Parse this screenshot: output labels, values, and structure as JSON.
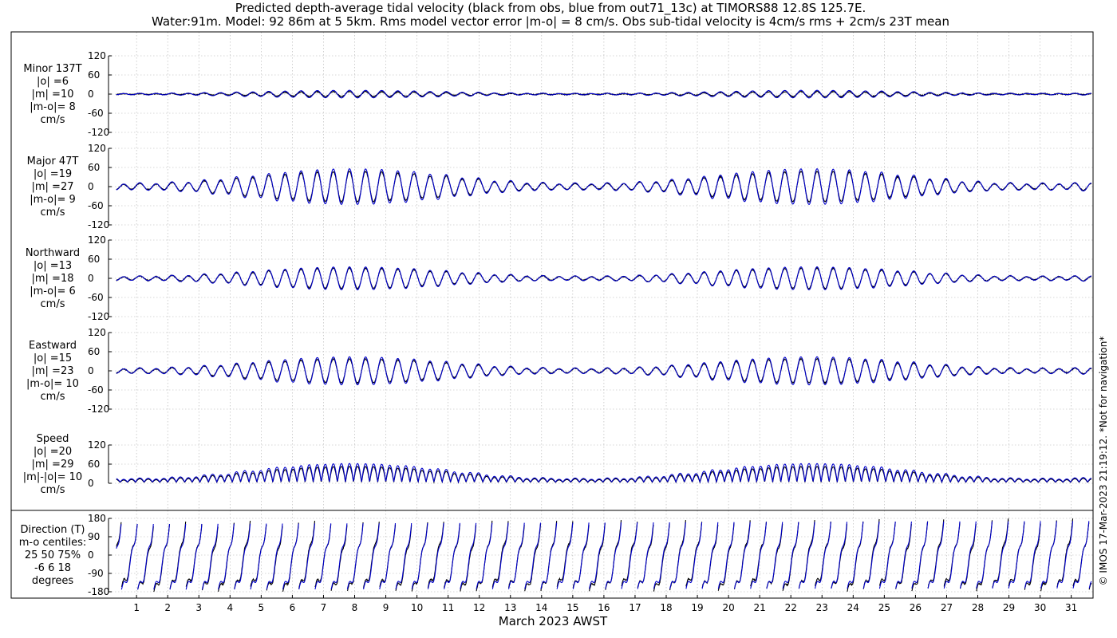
{
  "title_line1": "Predicted depth-average tidal velocity (black from obs, blue from out71_13c) at TIMORS88 12.8S 125.7E.",
  "title_line2": "Water:91m. Model: 92 86m at 5 5km. Rms model vector error |m-o| = 8 cm/s. Obs sub-tidal velocity is 4cm/s rms + 2cm/s 23T mean",
  "side_note": "© IMOS 17-Mar-2023 21:19:12. *Not for navigation*",
  "colors": {
    "obs": "#000000",
    "model": "#0000cc",
    "grid": "#b0b0b0"
  },
  "chart_data": {
    "type": "line",
    "xlabel": "March 2023 AWST",
    "x_ticks": [
      "1",
      "2",
      "3",
      "4",
      "5",
      "6",
      "7",
      "8",
      "9",
      "10",
      "11",
      "12",
      "13",
      "14",
      "15",
      "16",
      "17",
      "18",
      "19",
      "20",
      "21",
      "22",
      "23",
      "24",
      "25",
      "26",
      "27",
      "28",
      "29",
      "30",
      "31"
    ],
    "xlim_days": [
      0.1,
      31.7
    ],
    "series": [
      {
        "name": "black from obs",
        "color": "#000000"
      },
      {
        "name": "blue from out71_13c",
        "color": "#0000cc"
      }
    ],
    "panels": [
      {
        "id": "minor",
        "labels": [
          "Minor 137T",
          "|o| =6",
          "|m| =10",
          "|m-o|= 8",
          "cm/s"
        ],
        "ylim": [
          -120,
          120
        ],
        "yticks": [
          "120",
          "60",
          "0",
          "-60",
          "-120"
        ],
        "obs_amp": 8,
        "model_amp": 12
      },
      {
        "id": "major",
        "labels": [
          "Major 47T",
          "|o| =19",
          "|m| =27",
          "|m-o|= 9",
          "cm/s"
        ],
        "ylim": [
          -120,
          120
        ],
        "yticks": [
          "120",
          "60",
          "0",
          "-60",
          "-120"
        ],
        "obs_amp": 48,
        "model_amp": 56
      },
      {
        "id": "northward",
        "labels": [
          "Northward",
          "|o| =13",
          "|m| =18",
          "|m-o|= 6",
          "cm/s"
        ],
        "ylim": [
          -120,
          120
        ],
        "yticks": [
          "120",
          "60",
          "0",
          "-60",
          "-120"
        ],
        "obs_amp": 32,
        "model_amp": 36
      },
      {
        "id": "eastward",
        "labels": [
          "Eastward",
          "|o| =15",
          "|m| =23",
          "|m-o|= 10",
          "cm/s"
        ],
        "ylim": [
          -120,
          120
        ],
        "yticks": [
          "120",
          "60",
          "0",
          "-60",
          "-120"
        ],
        "obs_amp": 38,
        "model_amp": 44
      },
      {
        "id": "speed",
        "labels": [
          "Speed",
          "|o| =20",
          "|m| =29",
          "|m|-|o|= 10",
          "cm/s"
        ],
        "ylim": [
          0,
          120
        ],
        "yticks": [
          "120",
          "60",
          "0"
        ],
        "obs_amp": 50,
        "model_amp": 58
      },
      {
        "id": "direction",
        "labels": [
          "Direction (T)",
          "m-o centiles:",
          "25  50  75%",
          "-6   6  18",
          "degrees"
        ],
        "ylim": [
          -180,
          180
        ],
        "yticks": [
          "180",
          "90",
          "0",
          "-90",
          "-180"
        ]
      }
    ]
  }
}
